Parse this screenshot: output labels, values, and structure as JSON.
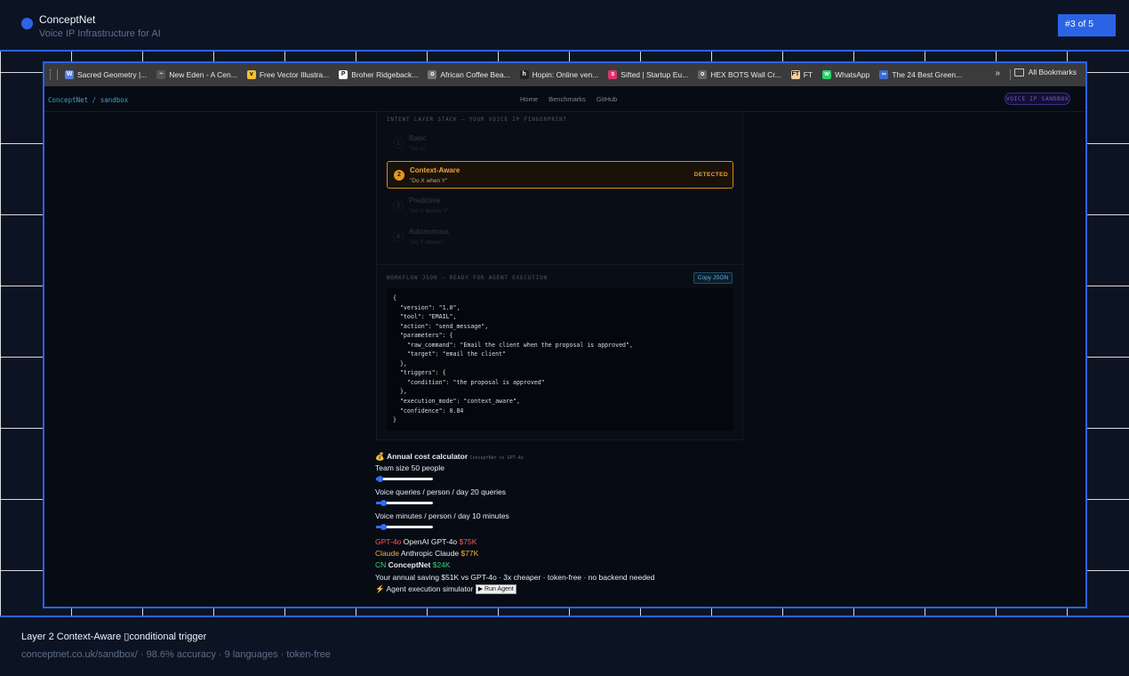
{
  "header": {
    "brand": "ConceptNet",
    "tagline": "Voice IP Infrastructure for AI",
    "slide_counter": "#3 of 5"
  },
  "bookmarks": [
    {
      "label": "Sacred Geometry |...",
      "icon": "wordpress-icon",
      "color": "#5b7dde",
      "glyph": "W"
    },
    {
      "label": "New Eden - A Cen...",
      "icon": "swirl-icon",
      "color": "#555555",
      "glyph": "~"
    },
    {
      "label": "Free Vector Illustra...",
      "icon": "freepik-icon",
      "color": "#f2c12e",
      "glyph": "v"
    },
    {
      "label": "Broher Ridgeback...",
      "icon": "patreon-icon",
      "color": "#ffffff",
      "glyph": "P"
    },
    {
      "label": "African Coffee Bea...",
      "icon": "bean-icon",
      "color": "#777777",
      "glyph": "o"
    },
    {
      "label": "Hopin: Online ven...",
      "icon": "hopin-icon",
      "color": "#222222",
      "glyph": "h"
    },
    {
      "label": "Sifted | Startup Eu...",
      "icon": "sifted-icon",
      "color": "#e0336b",
      "glyph": "s"
    },
    {
      "label": "HEX BOTS Wall Cr...",
      "icon": "globe-icon",
      "color": "#666666",
      "glyph": "o"
    },
    {
      "label": "FT",
      "icon": "ft-icon",
      "color": "#f4cfa0",
      "glyph": "FT"
    },
    {
      "label": "WhatsApp",
      "icon": "whatsapp-icon",
      "color": "#25d366",
      "glyph": "w"
    },
    {
      "label": "The 24 Best Green...",
      "icon": "link-icon",
      "color": "#3b6bd6",
      "glyph": "∞"
    }
  ],
  "bookmarks_more": "»",
  "all_bookmarks": "All Bookmarks",
  "site": {
    "breadcrumb": "ConceptNet / sandbox",
    "nav": [
      "Home",
      "Benchmarks",
      "GitHub"
    ],
    "pill": "VOICE IP SANDBOX"
  },
  "intent_panel": {
    "title": "INTENT LAYER STACK — YOUR VOICE IP FINGERPRINT",
    "layers": [
      {
        "num": "1",
        "name": "Basic",
        "sub": "\"Do X\""
      },
      {
        "num": "2",
        "name": "Context-Aware",
        "sub": "\"Do X when Y\""
      },
      {
        "num": "3",
        "name": "Predictive",
        "sub": "\"Do X before Y\""
      },
      {
        "num": "4",
        "name": "Autonomous",
        "sub": "\"Do Y always\""
      }
    ],
    "active_layer": 2,
    "detected_label": "DETECTED"
  },
  "workflow": {
    "title": "WORKFLOW JSON — READY FOR AGENT EXECUTION",
    "copy_label": "Copy JSON",
    "code": "{\n  \"version\": \"1.0\",\n  \"tool\": \"EMAIL\",\n  \"action\": \"send_message\",\n  \"parameters\": {\n    \"raw_command\": \"Email the client when the proposal is approved\",\n    \"target\": \"email the client\"\n  },\n  \"triggers\": {\n    \"condition\": \"the proposal is approved\"\n  },\n  \"execution_mode\": \"context_aware\",\n  \"confidence\": 0.84\n}"
  },
  "calculator": {
    "icon": "💰",
    "title": "Annual cost calculator",
    "note": "ConceptNet vs GPT-4o",
    "sliders": [
      {
        "label": "Team size",
        "value": "50 people",
        "level": 0.02
      },
      {
        "label": "Voice queries / person / day",
        "value": "20 queries",
        "level": 0.08
      },
      {
        "label": "Voice minutes / person / day",
        "value": "10 minutes",
        "level": 0.08
      }
    ],
    "providers": [
      {
        "tag": "GPT-4o",
        "name": "OpenAI GPT-4o",
        "cost": "$75K",
        "color": "#ff5a5a"
      },
      {
        "tag": "Claude",
        "name": "Anthropic Claude",
        "cost": "$77K",
        "color": "#ffb02e"
      },
      {
        "tag": "CN",
        "name": "ConceptNet",
        "cost": "$24K",
        "color": "#34d37a"
      }
    ],
    "saving": "Your annual saving $51K vs GPT-4o · 3x cheaper · token-free · no backend needed",
    "agent_icon": "⚡",
    "agent_label": "Agent execution simulator",
    "run_label": "▶ Run Agent"
  },
  "footer": {
    "caption": "Layer 2 Context-Aware ▯conditional trigger",
    "subcaption": "conceptnet.co.uk/sandbox/ · 98.6% accuracy · 9 languages · token-free"
  },
  "colors": {
    "accent": "#2b63e6",
    "detected": "#f0a034",
    "background": "#0c1424"
  }
}
